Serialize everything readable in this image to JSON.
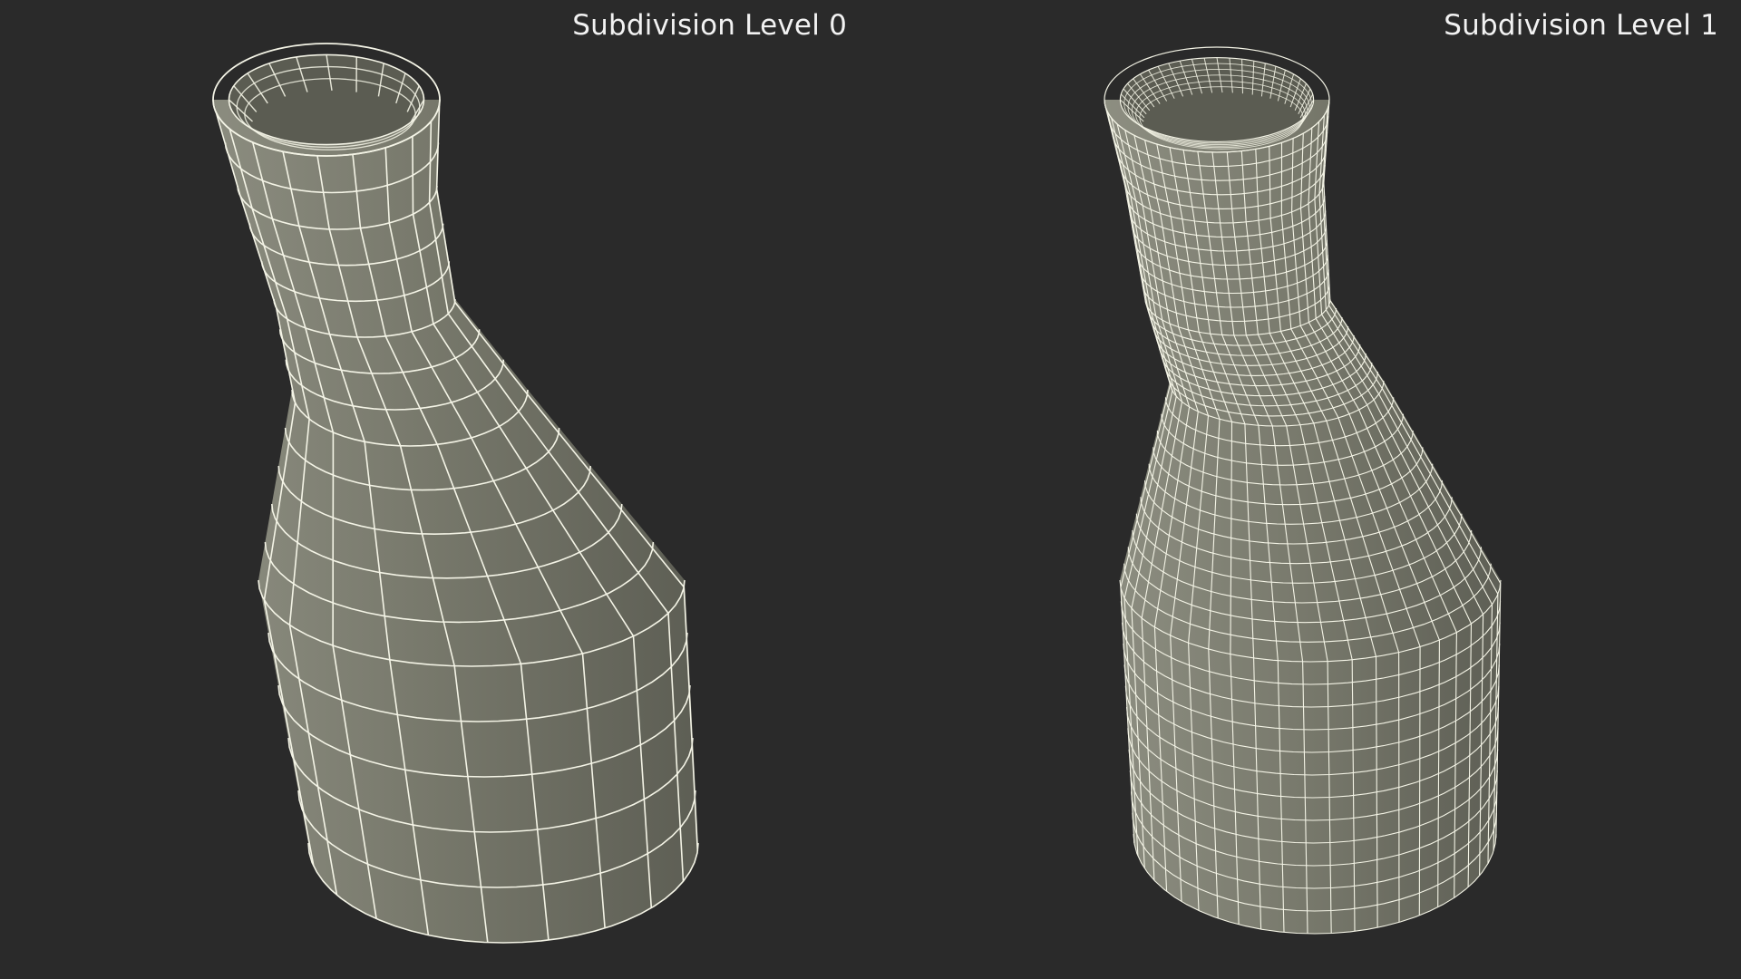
{
  "viewports": [
    {
      "label": "Subdivision Level 0",
      "mesh": "erlenmeyer-flask",
      "subdivision_level": 0
    },
    {
      "label": "Subdivision Level 1",
      "mesh": "erlenmeyer-flask",
      "subdivision_level": 1
    }
  ],
  "colors": {
    "background": "#2a2a2a",
    "surface": "#76776a",
    "wire": "#f4f4e6",
    "label": "#f2f2f2"
  }
}
